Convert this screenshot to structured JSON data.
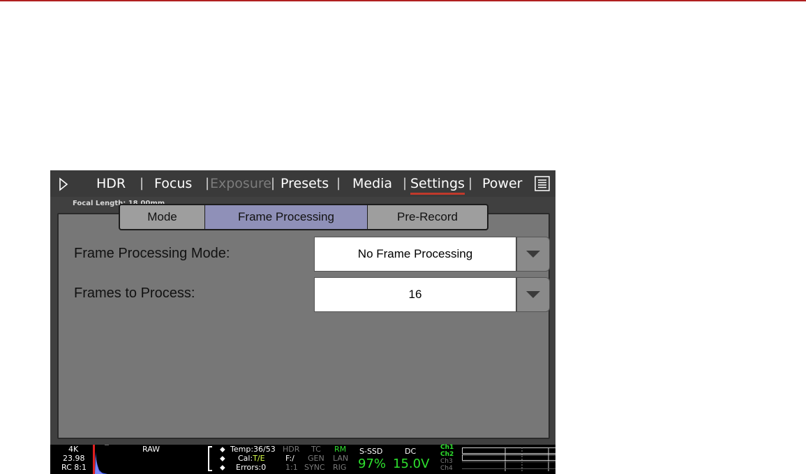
{
  "colors": {
    "top_rule": "#b02020",
    "accent_underline": "#c0392b",
    "active_tab": "#8f90b8",
    "status_green": "#2ee02e"
  },
  "nav": {
    "play_icon": "play-outline-icon",
    "items": [
      {
        "label": "HDR",
        "state": "normal"
      },
      {
        "label": "Focus",
        "state": "normal"
      },
      {
        "label": "Exposure",
        "state": "disabled"
      },
      {
        "label": "Presets",
        "state": "normal"
      },
      {
        "label": "Media",
        "state": "normal"
      },
      {
        "label": "Settings",
        "state": "active"
      },
      {
        "label": "Power",
        "state": "normal"
      }
    ],
    "separator": "|",
    "menu_icon": "list-menu-icon"
  },
  "main": {
    "focal_label": "Focal Length: 18.00mm",
    "tabs": [
      {
        "label": "Mode"
      },
      {
        "label": "Frame Processing",
        "selected": true
      },
      {
        "label": "Pre-Record"
      }
    ],
    "fields": [
      {
        "label": "Frame Processing Mode:",
        "value": "No Frame Processing"
      },
      {
        "label": "Frames to Process:",
        "value": "16"
      }
    ]
  },
  "status": {
    "resolution": "4K",
    "fps": "23.98",
    "compression": "RC 8:1",
    "format": "RAW",
    "temp": "Temp:36/53",
    "cal_prefix": "Cal:",
    "cal_value": "T/E",
    "errors": "Errors:0",
    "hdr": "HDR",
    "f": "F:/",
    "ratio": "1:1",
    "tc": "TC",
    "gen": "GEN",
    "sync": "SYNC",
    "rm": "RM",
    "lan": "LAN",
    "rig": "RIG",
    "media_label": "S-SSD",
    "media_value": "97%",
    "power_label": "DC",
    "power_value": "15.0V",
    "channels": [
      "Ch1",
      "Ch2",
      "Ch3",
      "Ch4"
    ]
  }
}
